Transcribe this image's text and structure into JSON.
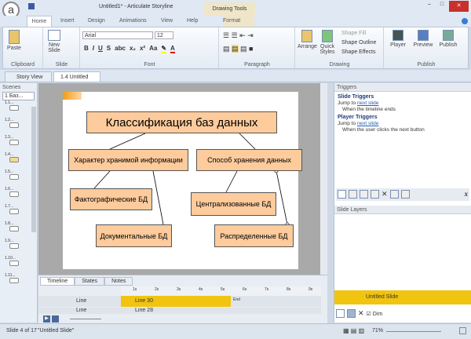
{
  "window": {
    "title": "Untitled1* - Articulate Storyline",
    "context_tab": "Drawing Tools"
  },
  "ribbon_tabs": [
    "Home",
    "Insert",
    "Design",
    "Animations",
    "View",
    "Help",
    "Format"
  ],
  "ribbon": {
    "clipboard": {
      "label": "Clipboard",
      "paste": "Paste"
    },
    "slide": {
      "label": "Slide",
      "new_slide": "New Slide"
    },
    "font": {
      "label": "Font",
      "font_name": "Arial",
      "font_size": "12",
      "bold": "B",
      "italic": "I",
      "underline": "U",
      "shadow": "S",
      "strike": "abc",
      "sub": "x₂",
      "sup": "x²",
      "case": "Aa"
    },
    "paragraph": {
      "label": "Paragraph"
    },
    "drawing": {
      "label": "Drawing",
      "arrange": "Arrange",
      "quick_styles": "Quick Styles",
      "shape_fill": "Shape Fill",
      "shape_outline": "Shape Outline",
      "shape_effects": "Shape Effects"
    },
    "publish": {
      "label": "Publish",
      "player": "Player",
      "preview": "Preview",
      "publish": "Publish"
    }
  },
  "doc_tabs": [
    "Story View",
    "1.4 Untitled Slide"
  ],
  "scenes": {
    "title": "Scenes",
    "selected": "1 Баз...",
    "slides": [
      "1.1...",
      "1.2...",
      "1.3...",
      "1.4...",
      "1.5...",
      "1.6...",
      "1.7...",
      "1.8...",
      "1.9...",
      "1.10...",
      "1.11..."
    ]
  },
  "slide": {
    "title": "Классификация баз данных",
    "nodes": [
      "Характер хранимой информации",
      "Способ хранения данных",
      "Фактографические БД",
      "Централизованные БД",
      "Документальные БД",
      "Распределенные БД"
    ]
  },
  "timeline": {
    "tabs": [
      "Timeline",
      "States",
      "Notes"
    ],
    "ticks": [
      "1s",
      "2s",
      "3s",
      "4s",
      "5s",
      "6s",
      "7s",
      "8s",
      "9s"
    ],
    "rows": [
      {
        "name": "Line",
        "bar": "Line 30"
      },
      {
        "name": "Line",
        "bar": "Line 28"
      }
    ],
    "end_label": "End"
  },
  "triggers": {
    "title": "Triggers",
    "slide_triggers": "Slide Triggers",
    "player_triggers": "Player Triggers",
    "items": [
      {
        "action": "Jump to",
        "target": "next slide",
        "when": "When the timeline ends"
      },
      {
        "action": "Jump to",
        "target": "next slide",
        "when": "When the user clicks the next button"
      }
    ]
  },
  "layers": {
    "title": "Slide Layers",
    "base": "Untitled Slide",
    "dim": "Dim"
  },
  "status": {
    "slide": "Slide 4 of 17",
    "name": "\"Untitled Slide\"",
    "zoom": "71%"
  },
  "colors": {
    "accent": "#f1c40f",
    "box": "#fdcb9c"
  }
}
